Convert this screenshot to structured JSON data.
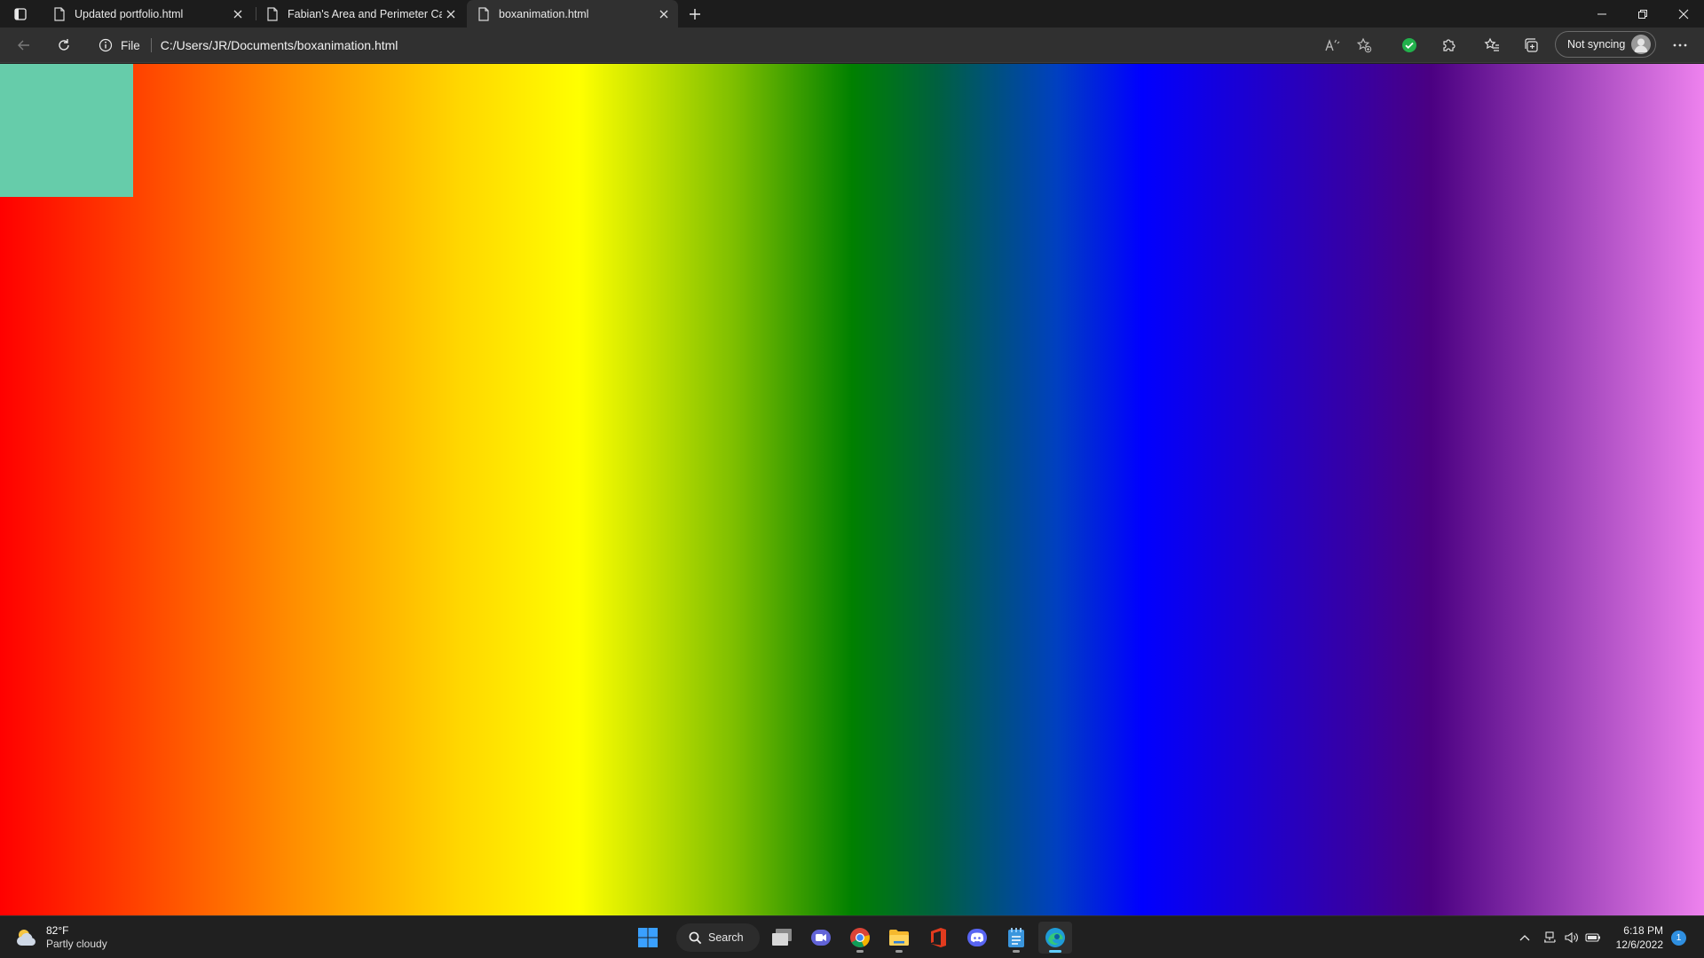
{
  "browser": {
    "tabs": [
      {
        "title": "Updated portfolio.html",
        "active": false
      },
      {
        "title": "Fabian's Area and Perimeter Calc",
        "active": false
      },
      {
        "title": "boxanimation.html",
        "active": true
      }
    ],
    "address": {
      "scheme_label": "File",
      "url": "C:/Users/JR/Documents/boxanimation.html"
    },
    "profile": {
      "label": "Not syncing"
    }
  },
  "page": {
    "gradient_colors": [
      "#ff0000",
      "#ff8c00",
      "#ffd700",
      "#ffff00",
      "#7fbf00",
      "#008000",
      "#006040",
      "#0040c0",
      "#0000ff",
      "#4b0082",
      "#ee82ee"
    ],
    "box_color": "#66ccaa"
  },
  "taskbar": {
    "weather": {
      "temp": "82°F",
      "condition": "Partly cloudy"
    },
    "search_label": "Search",
    "clock": {
      "time": "6:18 PM",
      "date": "12/6/2022"
    },
    "notification_count": "1",
    "accent_color": "#60cdff"
  }
}
